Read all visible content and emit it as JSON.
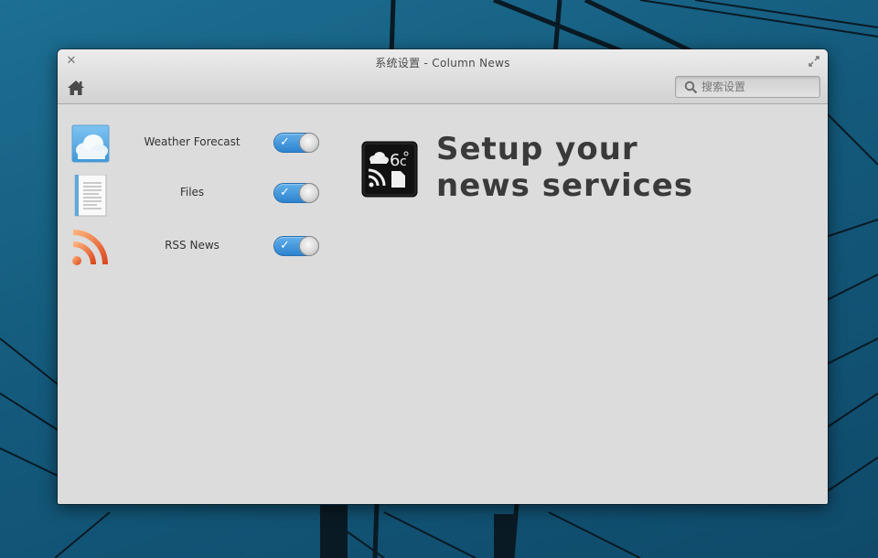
{
  "window": {
    "title": "系统设置 - Column News"
  },
  "toolbar": {
    "home_icon": "home-icon",
    "search_placeholder": "搜索设置"
  },
  "services": [
    {
      "label": "Weather Forecast",
      "icon": "weather-cloud-icon",
      "enabled": true
    },
    {
      "label": "Files",
      "icon": "document-file-icon",
      "enabled": true
    },
    {
      "label": "RSS News",
      "icon": "rss-feed-icon",
      "enabled": true
    }
  ],
  "main": {
    "logo_icon": "column-news-logo-icon",
    "logo_temperature": "6",
    "logo_unit": "c",
    "heading_line1": "Setup your",
    "heading_line2": "news services"
  },
  "colors": {
    "toggle_on": "#3d93dc",
    "rss_orange": "#e8682c",
    "window_bg": "#dcdcdc"
  }
}
